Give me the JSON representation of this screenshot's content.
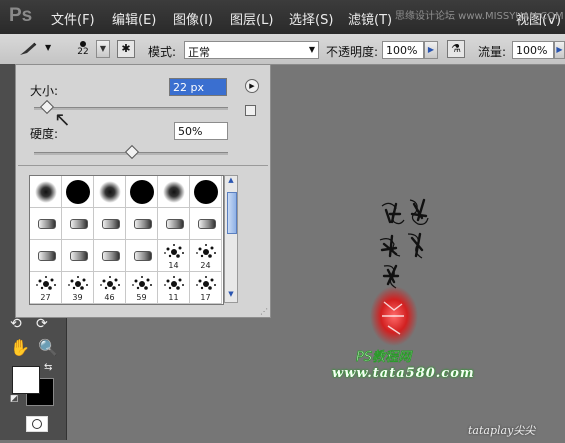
{
  "app": {
    "logo": "Ps"
  },
  "menubar": {
    "items": [
      "文件(F)",
      "编辑(E)",
      "图像(I)",
      "图层(L)",
      "选择(S)",
      "滤镜(T)",
      "视图(V)"
    ],
    "watermark": "思缘设计论坛 www.MISSYUAN.COM"
  },
  "options": {
    "brush_size_value": "22",
    "mode_label": "模式:",
    "mode_value": "正常",
    "opacity_label": "不透明度:",
    "opacity_value": "100%",
    "flow_label": "流量:",
    "flow_value": "100%"
  },
  "picker": {
    "size_label": "大小:",
    "size_value": "22 px",
    "size_fraction": 0.06,
    "hardness_label": "硬度:",
    "hardness_value": "50%",
    "hardness_fraction": 0.5,
    "presets": [
      {
        "kind": "soft",
        "label": ""
      },
      {
        "kind": "hard",
        "label": ""
      },
      {
        "kind": "soft",
        "label": ""
      },
      {
        "kind": "hard",
        "label": ""
      },
      {
        "kind": "soft",
        "label": ""
      },
      {
        "kind": "hard",
        "label": ""
      },
      {
        "kind": "tip",
        "label": ""
      },
      {
        "kind": "tip",
        "label": ""
      },
      {
        "kind": "tip",
        "label": ""
      },
      {
        "kind": "tip",
        "label": ""
      },
      {
        "kind": "tip",
        "label": ""
      },
      {
        "kind": "tip",
        "label": ""
      },
      {
        "kind": "tip",
        "label": ""
      },
      {
        "kind": "tip",
        "label": ""
      },
      {
        "kind": "tip",
        "label": ""
      },
      {
        "kind": "tip",
        "label": ""
      },
      {
        "kind": "splat",
        "label": "14"
      },
      {
        "kind": "splat",
        "label": "24"
      },
      {
        "kind": "splat",
        "label": "27"
      },
      {
        "kind": "splat",
        "label": "39"
      },
      {
        "kind": "splat",
        "label": "46"
      },
      {
        "kind": "splat",
        "label": "59"
      },
      {
        "kind": "splat",
        "label": "11"
      },
      {
        "kind": "splat",
        "label": "17"
      }
    ]
  },
  "canvas": {
    "stamp_url": "www.tata580.com",
    "credit": "tataplay尖尖"
  },
  "colors": {
    "accent": "#3a6fd0",
    "stamp_red": "#d22020",
    "stamp_green": "#2a9a2a"
  }
}
